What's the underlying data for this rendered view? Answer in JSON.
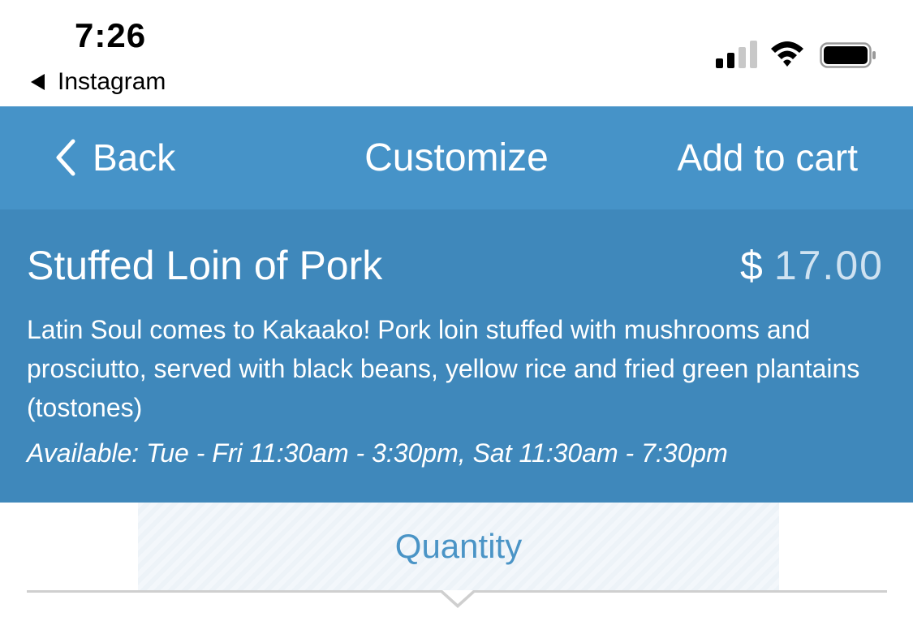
{
  "status_bar": {
    "time": "7:26",
    "back_app_label": "Instagram",
    "icons": [
      "cellular-signal-icon",
      "wifi-icon",
      "battery-icon"
    ]
  },
  "nav": {
    "back_label": "Back",
    "title": "Customize",
    "add_to_cart_label": "Add to cart",
    "background_color": "#4693c8"
  },
  "item": {
    "name": "Stuffed Loin of Pork",
    "price_currency": "$",
    "price_amount": "17.00",
    "description": "Latin Soul comes to Kakaako! Pork loin stuffed with mushrooms and prosciutto, served with black beans, yellow rice and fried green plantains (tostones)",
    "availability": "Available: Tue - Fri 11:30am - 3:30pm, Sat 11:30am - 7:30pm",
    "background_color": "#3f88bb"
  },
  "quantity": {
    "label": "Quantity",
    "accent_color": "#4a94c6"
  }
}
